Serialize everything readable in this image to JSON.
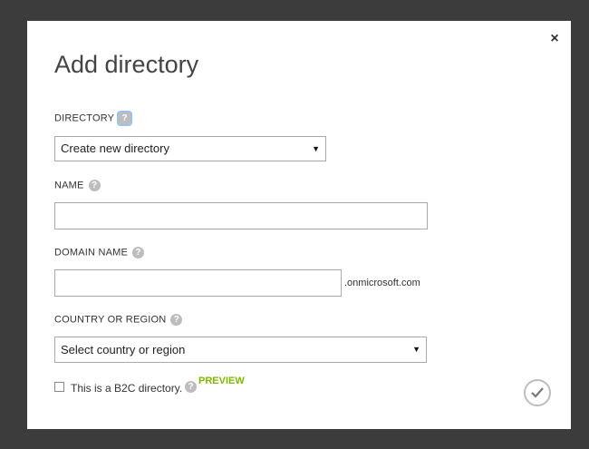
{
  "dialog": {
    "title": "Add directory",
    "close_icon": "close-icon",
    "ok_icon": "checkmark-icon"
  },
  "fields": {
    "directory": {
      "label": "DIRECTORY",
      "value": "Create new directory"
    },
    "name": {
      "label": "NAME",
      "value": ""
    },
    "domain": {
      "label": "DOMAIN NAME",
      "value": "",
      "suffix": ".onmicrosoft.com"
    },
    "country": {
      "label": "COUNTRY OR REGION",
      "value": "Select country or region"
    }
  },
  "b2c": {
    "label": "This is a B2C directory.",
    "badge": "PREVIEW",
    "checked": false
  },
  "colors": {
    "accent_green": "#7fba00",
    "backdrop": "#3c3c3c"
  },
  "help_glyph": "?",
  "close_glyph": "×",
  "arrow_glyph": "▼"
}
